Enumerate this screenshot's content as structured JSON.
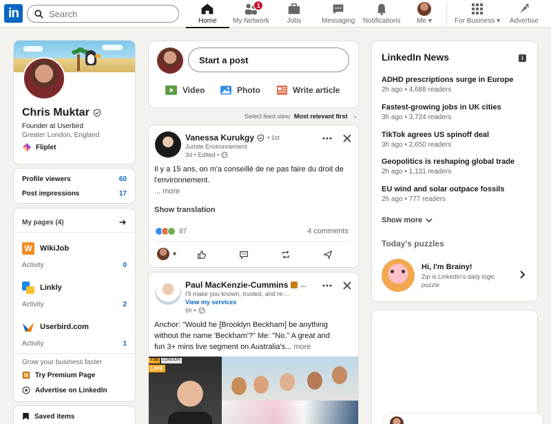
{
  "nav": {
    "logo_text": "in",
    "search_placeholder": "Search",
    "items": [
      {
        "label": "Home",
        "icon": "home-icon",
        "active": true
      },
      {
        "label": "My Network",
        "icon": "network-icon",
        "badge": "1"
      },
      {
        "label": "Jobs",
        "icon": "briefcase-icon"
      },
      {
        "label": "Messaging",
        "icon": "messaging-icon"
      },
      {
        "label": "Notifications",
        "icon": "bell-icon"
      },
      {
        "label": "Me",
        "icon": "avatar"
      },
      {
        "label": "For Business",
        "icon": "grid-icon"
      },
      {
        "label": "Advertise",
        "icon": "advertise-icon"
      }
    ]
  },
  "profile": {
    "name": "Chris Muktar",
    "headline": "Founder at Userbird",
    "location": "Greater London, England",
    "company": "Fliplet",
    "stats": [
      {
        "label": "Profile viewers",
        "value": "60"
      },
      {
        "label": "Post impressions",
        "value": "17"
      }
    ]
  },
  "my_pages": {
    "header": "My pages (4)",
    "pages": [
      {
        "name": "WikiJob",
        "activity_label": "Activity",
        "activity": "0",
        "color": "#f08a24"
      },
      {
        "name": "Linkly",
        "activity_label": "Activity",
        "activity": "2",
        "color": "#1e88e5"
      },
      {
        "name": "Userbird.com",
        "activity_label": "Activity",
        "activity": "1",
        "color": "#f57c00"
      }
    ],
    "grow_text": "Grow your business faster",
    "premium_link": "Try Premium Page",
    "advertise_link": "Advertise on LinkedIn",
    "saved_items": "Saved items"
  },
  "composer": {
    "start_post": "Start a post",
    "video": "Video",
    "photo": "Photo",
    "article": "Write article"
  },
  "feed_sort": {
    "label": "Select feed view:",
    "value": "Most relevant first"
  },
  "post1": {
    "author": "Vanessa Kurukgy",
    "degree": "• 1st",
    "headline": "Juriste Environnement",
    "time": "3d • Edited •",
    "body_line1": "Il y a 15 ans, on m'a conseillé de ne pas faire du droit de",
    "body_line2": "l'environnement.",
    "more": "... more",
    "translate": "Show translation",
    "reactions": "87",
    "comments": "4 comments"
  },
  "post2": {
    "author": "Paul MacKenzie-Cummins",
    "headline": "I'll make you known, trusted, and re-...",
    "services": "View my services",
    "time": "6h •",
    "body_line1": "Anchor: \"Would he [Brooklyn Beckham] be anything",
    "body_line2": "without the name 'Beckham'?\" Me: \"No.\" A great and",
    "body_line3": "fun 3+ mins live segment on Australia's...",
    "more": "more",
    "video_tag_live": "LIVE",
    "video_tag_time": "7:25",
    "video_tag_loc": "LONDON"
  },
  "news": {
    "title": "LinkedIn News",
    "items": [
      {
        "headline": "ADHD prescriptions surge in Europe",
        "meta": "2h ago • 4,688 readers"
      },
      {
        "headline": "Fastest-growing jobs in UK cities",
        "meta": "3h ago • 3,724 readers"
      },
      {
        "headline": "TikTok agrees US spinoff deal",
        "meta": "3h ago • 2,650 readers"
      },
      {
        "headline": "Geopolitics is reshaping global trade",
        "meta": "2h ago • 1,131 readers"
      },
      {
        "headline": "EU wind and solar outpace fossils",
        "meta": "2h ago • 777 readers"
      }
    ],
    "show_more": "Show more",
    "puzzles_title": "Today's puzzles",
    "puzzle_name": "Hi, I'm Brainy!",
    "puzzle_desc_1": "Zip is LinkedIn's daily logic",
    "puzzle_desc_2": "puzzle"
  },
  "colors": {
    "brand": "#0a66c2",
    "background": "#f4f2ee",
    "badge": "#cb112d"
  }
}
